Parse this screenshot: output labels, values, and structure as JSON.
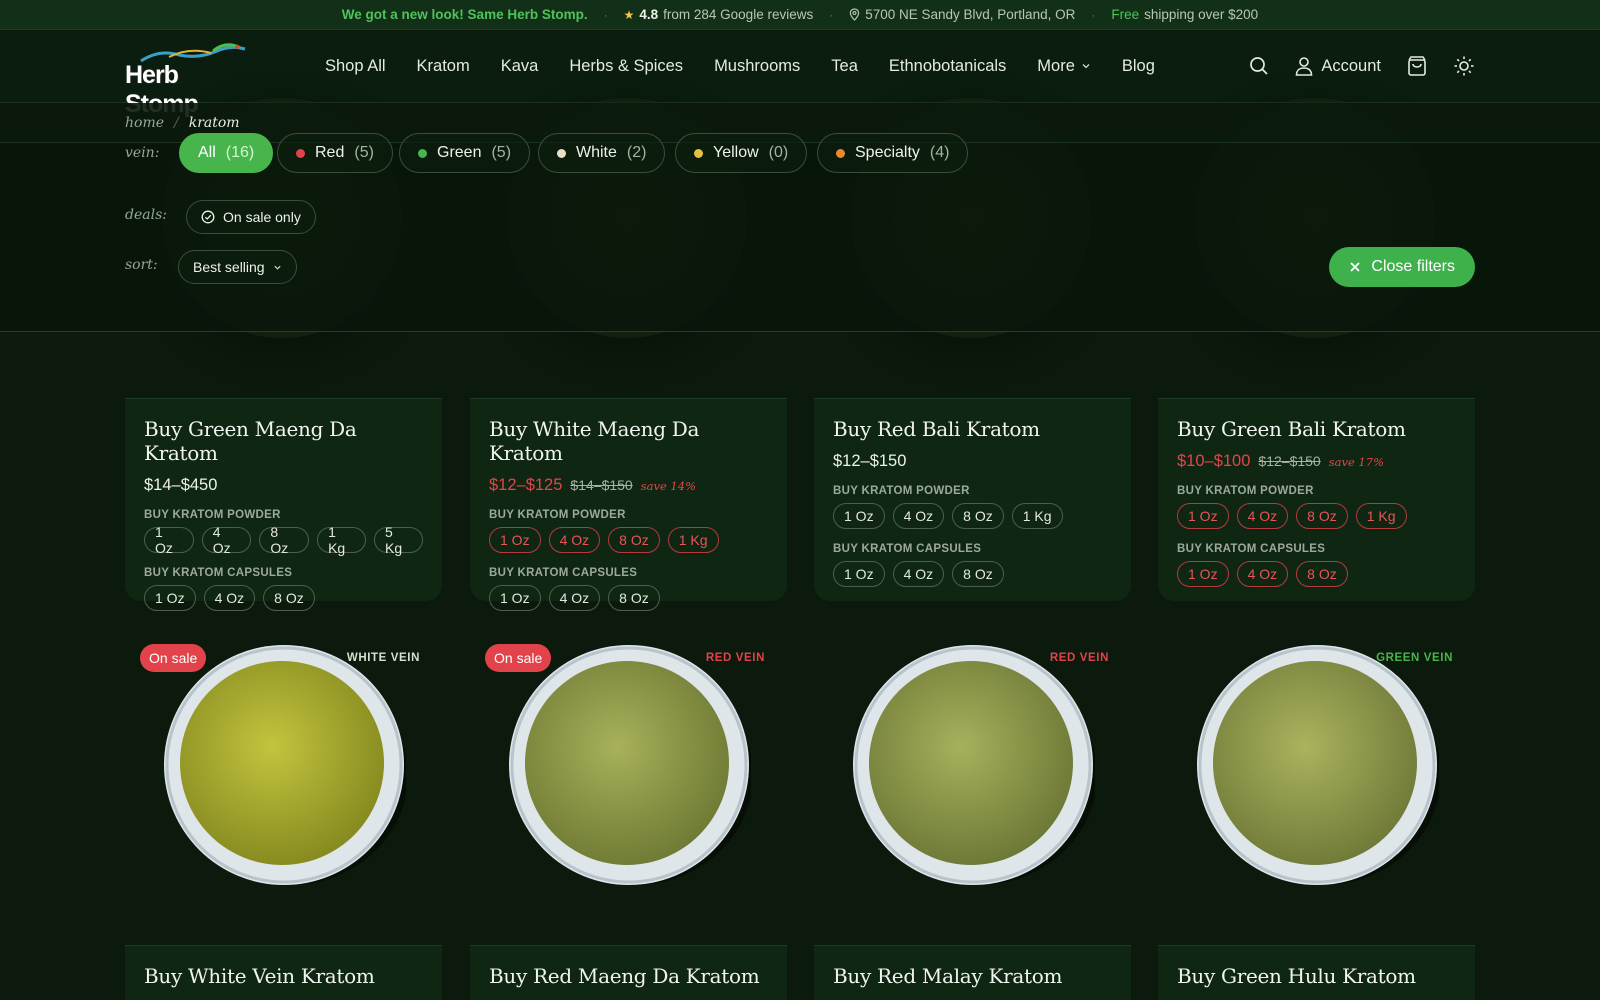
{
  "announcement": {
    "new_look": "We got a new look! Same Herb Stomp.",
    "rating": "4.8",
    "reviews": "from 284 Google reviews",
    "address": "5700 NE Sandy Blvd, Portland, OR",
    "free": "Free",
    "shipping": "shipping over $200"
  },
  "brand": {
    "name": "Herb Stomp"
  },
  "nav": {
    "items": [
      "Shop All",
      "Kratom",
      "Kava",
      "Herbs & Spices",
      "Mushrooms",
      "Tea",
      "Ethnobotanicals"
    ],
    "more": "More",
    "blog": "Blog",
    "account": "Account"
  },
  "breadcrumb": {
    "home": "home",
    "separator": "/",
    "current": "kratom"
  },
  "filters": {
    "vein_label": "vein:",
    "veins": [
      {
        "label": "All",
        "count": "(16)",
        "color": ""
      },
      {
        "label": "Red",
        "count": "(5)",
        "color": "#e2434a"
      },
      {
        "label": "Green",
        "count": "(5)",
        "color": "#47b54c"
      },
      {
        "label": "White",
        "count": "(2)",
        "color": "#e8e0c6"
      },
      {
        "label": "Yellow",
        "count": "(0)",
        "color": "#e4c13e"
      },
      {
        "label": "Specialty",
        "count": "(4)",
        "color": "#e88a2c"
      }
    ],
    "deals_label": "deals:",
    "on_sale": "On sale only",
    "sort_label": "sort:",
    "sort_value": "Best selling",
    "close": "Close filters"
  },
  "products_top": [
    {
      "title": "Buy Green Maeng Da Kratom",
      "price": "$14–$450",
      "old_price": "",
      "save": "",
      "on_sale": false,
      "powder_label": "BUY KRATOM POWDER",
      "powder": [
        "1 Oz",
        "4 Oz",
        "8 Oz",
        "1 Kg",
        "5 Kg"
      ],
      "capsules_label": "BUY KRATOM CAPSULES",
      "capsules": [
        "1 Oz",
        "4 Oz",
        "8 Oz"
      ]
    },
    {
      "title": "Buy White Maeng Da Kratom",
      "price": "$12–$125",
      "old_price": "$14–$150",
      "save": "save 14%",
      "on_sale": true,
      "powder_label": "BUY KRATOM POWDER",
      "powder": [
        "1 Oz",
        "4 Oz",
        "8 Oz",
        "1 Kg"
      ],
      "capsules_label": "BUY KRATOM CAPSULES",
      "capsules": [
        "1 Oz",
        "4 Oz",
        "8 Oz"
      ]
    },
    {
      "title": "Buy Red Bali Kratom",
      "price": "$12–$150",
      "old_price": "",
      "save": "",
      "on_sale": false,
      "powder_label": "BUY KRATOM POWDER",
      "powder": [
        "1 Oz",
        "4 Oz",
        "8 Oz",
        "1 Kg"
      ],
      "capsules_label": "BUY KRATOM CAPSULES",
      "capsules": [
        "1 Oz",
        "4 Oz",
        "8 Oz"
      ]
    },
    {
      "title": "Buy Green Bali Kratom",
      "price": "$10–$100",
      "old_price": "$12–$150",
      "save": "save 17%",
      "on_sale": true,
      "powder_label": "BUY KRATOM POWDER",
      "powder": [
        "1 Oz",
        "4 Oz",
        "8 Oz",
        "1 Kg"
      ],
      "capsules_label": "BUY KRATOM CAPSULES",
      "capsules": [
        "1 Oz",
        "4 Oz",
        "8 Oz"
      ]
    }
  ],
  "products_bottom": [
    {
      "title": "Buy White Vein Kratom",
      "sale_badge": "On sale",
      "vein": "WHITE VEIN",
      "vein_color": "#d8dfd3",
      "powder_color": "#a9ad2f"
    },
    {
      "title": "Buy Red Maeng Da Kratom",
      "sale_badge": "On sale",
      "vein": "RED VEIN",
      "vein_color": "#e2434a",
      "powder_color": "#8d9a48"
    },
    {
      "title": "Buy Red Malay Kratom",
      "sale_badge": "",
      "vein": "RED VEIN",
      "vein_color": "#e2434a",
      "powder_color": "#8c9a4a"
    },
    {
      "title": "Buy Green Hulu Kratom",
      "sale_badge": "",
      "vein": "GREEN VEIN",
      "vein_color": "#47b54c",
      "powder_color": "#8f9c4c"
    }
  ]
}
